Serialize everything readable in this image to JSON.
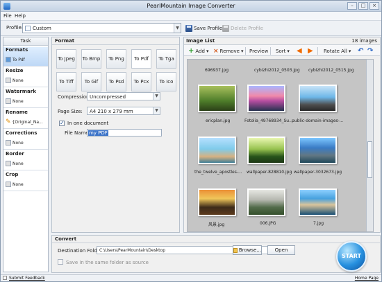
{
  "window": {
    "title": "PearlMountain Image Converter"
  },
  "menu": {
    "file": "File",
    "help": "Help"
  },
  "profile": {
    "label": "Profile:",
    "value": "Custom",
    "save_profile": "Save Profile",
    "delete_profile": "Delete Profile"
  },
  "task": {
    "header": "Task",
    "items": [
      {
        "title": "Formats",
        "value": "To Pdf"
      },
      {
        "title": "Resize",
        "value": "None"
      },
      {
        "title": "Watermark",
        "value": "None"
      },
      {
        "title": "Rename",
        "value": "{Original_Na..."
      },
      {
        "title": "Corrections",
        "value": "None"
      },
      {
        "title": "Border",
        "value": "None"
      },
      {
        "title": "Crop",
        "value": "None"
      }
    ]
  },
  "format": {
    "header": "Format",
    "buttons": [
      "To Jpeg",
      "To Bmp",
      "To Png",
      "To Pdf",
      "To Tga",
      "To Tiff",
      "To Gif",
      "To Psd",
      "To Pcx",
      "To Ico"
    ],
    "compression_label": "Compression:",
    "compression_value": "Uncompressed",
    "page_size_label": "Page Size:",
    "page_size_value": "A4 210 x 279 mm",
    "in_one_document": "In one document",
    "file_name_label": "File Name:",
    "file_name_value": "my PDF"
  },
  "image_list": {
    "header": "Image List",
    "count": "18 images",
    "toolbar": {
      "add": "Add",
      "remove": "Remove",
      "preview": "Preview",
      "sort": "Sort",
      "rotate_all": "Rotate All"
    },
    "top_names": [
      "696937.jpg",
      "cybizhi2012_0503.jpg",
      "cybizhi2012_0515.jpg"
    ],
    "items": [
      {
        "name": "ericplan.jpg"
      },
      {
        "name": "Fotolia_49768934_Su..."
      },
      {
        "name": "public-domain-images-..."
      },
      {
        "name": "the_twelve_apostles-..."
      },
      {
        "name": "wallpaper-828810.jpg"
      },
      {
        "name": "wallpaper-3032673.jpg"
      },
      {
        "name": "风景.jpg"
      },
      {
        "name": "006.JPG"
      },
      {
        "name": "7.jpg"
      }
    ]
  },
  "convert": {
    "header": "Convert",
    "destination_label": "Destination Folder:",
    "destination_value": "C:\\Users\\PearMountain\\Desktop",
    "browse": "Browse...",
    "open": "Open",
    "same_folder": "Save in the same folder as source",
    "start": "START"
  },
  "status": {
    "submit_feedback": "Submit Feedback",
    "home_page": "Home Page"
  }
}
